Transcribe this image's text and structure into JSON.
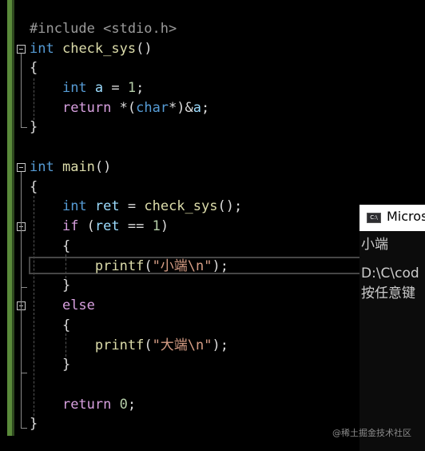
{
  "editor": {
    "include_line": "#include <stdio.h>",
    "check_sys": {
      "ret_type": "int",
      "name": "check_sys",
      "parens": "()",
      "open_brace": "{",
      "decl_type": "int",
      "decl_var": "a",
      "decl_assign": " = ",
      "decl_val": "1",
      "decl_semi": ";",
      "return_kw": "return",
      "return_expr_1": " *(",
      "return_cast": "char",
      "return_expr_2": "*)&",
      "return_var": "a",
      "return_semi": ";",
      "close_brace": "}"
    },
    "main": {
      "ret_type": "int",
      "name": "main",
      "parens": "()",
      "open_brace": "{",
      "decl_type": "int",
      "decl_var": "ret",
      "decl_assign": " = ",
      "decl_call": "check_sys",
      "decl_call_end": "();",
      "if_kw": "if",
      "if_open": " (",
      "if_var": "ret",
      "if_op": " == ",
      "if_val": "1",
      "if_close": ")",
      "if_open_brace": "{",
      "printf_1": "printf",
      "printf_1_open": "(",
      "printf_1_str": "\"小端\\n\"",
      "printf_1_close": ");",
      "if_close_brace": "}",
      "else_kw": "else",
      "else_open_brace": "{",
      "printf_2": "printf",
      "printf_2_open": "(",
      "printf_2_str": "\"大端\\n\"",
      "printf_2_close": ");",
      "else_close_brace": "}",
      "return_kw": "return",
      "return_val": "0",
      "return_semi": ";",
      "close_brace": "}"
    }
  },
  "console": {
    "icon": "C:\\",
    "title": "Micros",
    "output_line": "小端",
    "path_line": "D:\\C\\cod",
    "prompt_line": "按任意键"
  },
  "watermark": "@稀土掘金技术社区"
}
